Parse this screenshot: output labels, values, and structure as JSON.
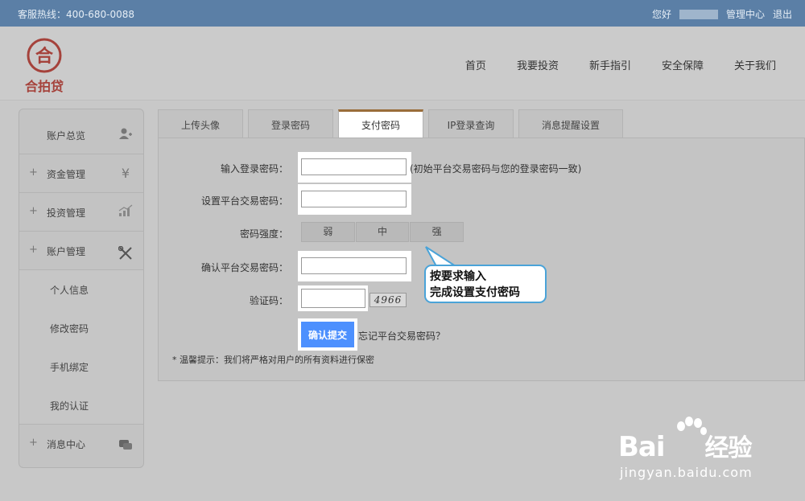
{
  "topbar": {
    "hotline": "客服热线：400-680-0088",
    "greeting": "您好",
    "admin_center": "管理中心",
    "logout": "退出"
  },
  "brand": {
    "logo_text": "合拍贷",
    "logo_glyph": "合"
  },
  "nav": [
    "首页",
    "我要投资",
    "新手指引",
    "安全保障",
    "关于我们"
  ],
  "sidebar": {
    "items": [
      {
        "label": "账户总览",
        "icon": "user-icon"
      },
      {
        "label": "资金管理",
        "icon": "yen-icon",
        "plus": "+"
      },
      {
        "label": "投资管理",
        "icon": "chart-icon",
        "plus": "+"
      },
      {
        "label": "账户管理",
        "icon": "tools-icon",
        "plus": "+"
      }
    ],
    "subitems": [
      "个人信息",
      "修改密码",
      "手机绑定",
      "我的认证"
    ],
    "footer_item": {
      "label": "消息中心",
      "icon": "chat-icon",
      "plus": "+"
    }
  },
  "tabs": [
    "上传头像",
    "登录密码",
    "支付密码",
    "IP登录查询",
    "消息提醒设置"
  ],
  "active_tab": "支付密码",
  "form": {
    "login_pwd_label": "输入登录密码：",
    "login_pwd_hint": "(初始平台交易密码与您的登录密码一致)",
    "set_trade_pwd_label": "设置平台交易密码：",
    "strength_label": "密码强度：",
    "strength_levels": [
      "弱",
      "中",
      "强"
    ],
    "confirm_trade_pwd_label": "确认平台交易密码：",
    "captcha_label": "验证码：",
    "captcha_text": "4966",
    "submit_label": "确认提交",
    "forgot_text": "忘记平台交易密码？",
    "note": "* 温馨提示：我们将严格对用户的所有资料进行保密"
  },
  "callout": {
    "line1": "按要求输入",
    "line2": "完成设置支付密码"
  },
  "watermark": {
    "brand": "Bai",
    "brand_cn": "经验",
    "url": "jingyan.baidu.com"
  },
  "colors": {
    "topbar": "#5b7fa6",
    "submit": "#4d90fe",
    "callout_border": "#4aa3d8",
    "active_tab_border": "#9a6d3a"
  }
}
